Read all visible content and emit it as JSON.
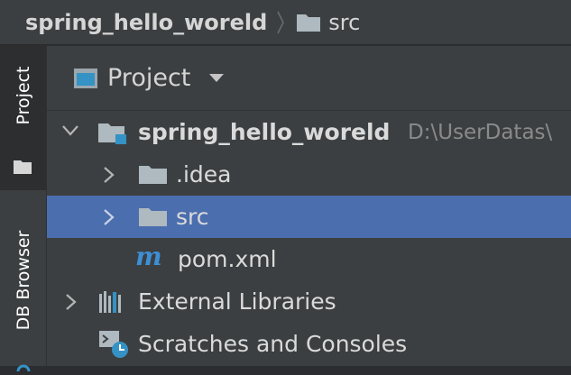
{
  "breadcrumb": {
    "project": "spring_hello_woreld",
    "current": "src"
  },
  "toolstrip": {
    "project_tab": "Project",
    "db_browser_tab": "DB Browser"
  },
  "panel": {
    "title": "Project"
  },
  "tree": {
    "root": {
      "label": "spring_hello_woreld",
      "path": "D:\\UserDatas\\"
    },
    "idea": {
      "label": ".idea"
    },
    "src": {
      "label": "src"
    },
    "pom": {
      "label": "pom.xml",
      "icon_glyph": "m"
    },
    "ext": {
      "label": "External Libraries"
    },
    "scratch": {
      "label": "Scratches and Consoles"
    }
  },
  "colors": {
    "selection": "#4b6eaf",
    "folder": "#aeb9c0",
    "maven": "#3d8fd6",
    "module_badge": "#3592c4"
  }
}
